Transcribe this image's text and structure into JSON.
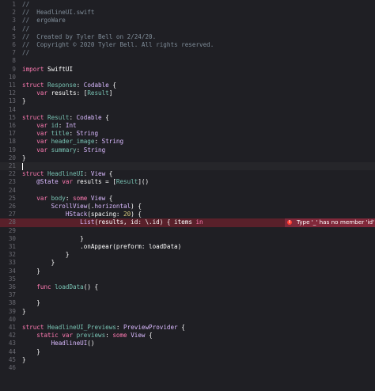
{
  "colors": {
    "background": "#1f1f24",
    "gutter": "#6a6a72",
    "comment": "#7f8c98",
    "keyword": "#ff7ab2",
    "type": "#dabaff",
    "identifier": "#78c2b3",
    "number": "#d9c97c",
    "plain": "#ffffff",
    "error_bg": "#80283a",
    "error_icon": "#ff3b30"
  },
  "error": {
    "line": 28,
    "icon": "error-circle-icon",
    "message": "Type '_' has no member 'id'"
  },
  "caret_line": 21,
  "lines": [
    {
      "n": "1",
      "t": [
        [
          "c",
          "//"
        ]
      ]
    },
    {
      "n": "2",
      "t": [
        [
          "c",
          "//  HeadlineUI.swift"
        ]
      ]
    },
    {
      "n": "3",
      "t": [
        [
          "c",
          "//  ergoWare"
        ]
      ]
    },
    {
      "n": "4",
      "t": [
        [
          "c",
          "//"
        ]
      ]
    },
    {
      "n": "5",
      "t": [
        [
          "c",
          "//  Created by Tyler Bell on 2/24/20."
        ]
      ]
    },
    {
      "n": "6",
      "t": [
        [
          "c",
          "//  Copyright © 2020 Tyler Bell. All rights reserved."
        ]
      ]
    },
    {
      "n": "7",
      "t": [
        [
          "c",
          "//"
        ]
      ]
    },
    {
      "n": "8",
      "t": []
    },
    {
      "n": "9",
      "t": [
        [
          "k",
          "import"
        ],
        [
          "p",
          " SwiftUI"
        ]
      ]
    },
    {
      "n": "10",
      "t": []
    },
    {
      "n": "11",
      "t": [
        [
          "k",
          "struct"
        ],
        [
          "p",
          " "
        ],
        [
          "i",
          "Response"
        ],
        [
          "p",
          ": "
        ],
        [
          "ty",
          "Codable"
        ],
        [
          "p",
          " {"
        ]
      ]
    },
    {
      "n": "12",
      "t": [
        [
          "p",
          "    "
        ],
        [
          "k",
          "var"
        ],
        [
          "p",
          " results: ["
        ],
        [
          "i",
          "Result"
        ],
        [
          "p",
          "]"
        ]
      ]
    },
    {
      "n": "13",
      "t": [
        [
          "p",
          "}"
        ]
      ]
    },
    {
      "n": "14",
      "t": []
    },
    {
      "n": "15",
      "t": [
        [
          "k",
          "struct"
        ],
        [
          "p",
          " "
        ],
        [
          "i",
          "Result"
        ],
        [
          "p",
          ": "
        ],
        [
          "ty",
          "Codable"
        ],
        [
          "p",
          " {"
        ]
      ]
    },
    {
      "n": "16",
      "t": [
        [
          "p",
          "    "
        ],
        [
          "k",
          "var"
        ],
        [
          "p",
          " "
        ],
        [
          "i",
          "id"
        ],
        [
          "p",
          ": "
        ],
        [
          "ty",
          "Int"
        ]
      ]
    },
    {
      "n": "17",
      "t": [
        [
          "p",
          "    "
        ],
        [
          "k",
          "var"
        ],
        [
          "p",
          " "
        ],
        [
          "i",
          "title"
        ],
        [
          "p",
          ": "
        ],
        [
          "ty",
          "String"
        ]
      ]
    },
    {
      "n": "18",
      "t": [
        [
          "p",
          "    "
        ],
        [
          "k",
          "var"
        ],
        [
          "p",
          " "
        ],
        [
          "i",
          "header_image"
        ],
        [
          "p",
          ": "
        ],
        [
          "ty",
          "String"
        ]
      ]
    },
    {
      "n": "19",
      "t": [
        [
          "p",
          "    "
        ],
        [
          "k",
          "var"
        ],
        [
          "p",
          " "
        ],
        [
          "i",
          "summary"
        ],
        [
          "p",
          ": "
        ],
        [
          "ty",
          "String"
        ]
      ]
    },
    {
      "n": "20",
      "t": [
        [
          "p",
          "}"
        ]
      ]
    },
    {
      "n": "21",
      "t": []
    },
    {
      "n": "22",
      "t": [
        [
          "k",
          "struct"
        ],
        [
          "p",
          " "
        ],
        [
          "i",
          "HeadlineUI"
        ],
        [
          "p",
          ": "
        ],
        [
          "ty",
          "View"
        ],
        [
          "p",
          " {"
        ]
      ]
    },
    {
      "n": "23",
      "t": [
        [
          "p",
          "    "
        ],
        [
          "ty",
          "@State"
        ],
        [
          "p",
          " "
        ],
        [
          "k",
          "var"
        ],
        [
          "p",
          " results = ["
        ],
        [
          "i",
          "Result"
        ],
        [
          "p",
          "]()"
        ]
      ]
    },
    {
      "n": "24",
      "t": []
    },
    {
      "n": "25",
      "t": [
        [
          "p",
          "    "
        ],
        [
          "k",
          "var"
        ],
        [
          "p",
          " "
        ],
        [
          "i",
          "body"
        ],
        [
          "p",
          ": "
        ],
        [
          "k",
          "some"
        ],
        [
          "p",
          " "
        ],
        [
          "ty",
          "View"
        ],
        [
          "p",
          " {"
        ]
      ]
    },
    {
      "n": "26",
      "t": [
        [
          "p",
          "        "
        ],
        [
          "ty",
          "ScrollView"
        ],
        [
          "p",
          "(."
        ],
        [
          "ty",
          "horizontal"
        ],
        [
          "p",
          ") {"
        ]
      ]
    },
    {
      "n": "27",
      "t": [
        [
          "p",
          "            "
        ],
        [
          "ty",
          "HStack"
        ],
        [
          "p",
          "(spacing: "
        ],
        [
          "num",
          "20"
        ],
        [
          "p",
          ") {"
        ]
      ]
    },
    {
      "n": "28",
      "t": [
        [
          "p",
          "                "
        ],
        [
          "ty",
          "List"
        ],
        [
          "p",
          "(results, id: \\.id) { items "
        ],
        [
          "k",
          "in"
        ]
      ]
    },
    {
      "n": "29",
      "t": []
    },
    {
      "n": "30",
      "t": [
        [
          "p",
          "                }"
        ]
      ]
    },
    {
      "n": "31",
      "t": [
        [
          "p",
          "                .onAppear(preform: loadData)"
        ]
      ]
    },
    {
      "n": "32",
      "t": [
        [
          "p",
          "            }"
        ]
      ]
    },
    {
      "n": "33",
      "t": [
        [
          "p",
          "        }"
        ]
      ]
    },
    {
      "n": "34",
      "t": [
        [
          "p",
          "    }"
        ]
      ]
    },
    {
      "n": "35",
      "t": []
    },
    {
      "n": "36",
      "t": [
        [
          "p",
          "    "
        ],
        [
          "k",
          "func"
        ],
        [
          "p",
          " "
        ],
        [
          "i",
          "loadData"
        ],
        [
          "p",
          "() {"
        ]
      ]
    },
    {
      "n": "37",
      "t": []
    },
    {
      "n": "38",
      "t": [
        [
          "p",
          "    }"
        ]
      ]
    },
    {
      "n": "39",
      "t": [
        [
          "p",
          "}"
        ]
      ]
    },
    {
      "n": "40",
      "t": []
    },
    {
      "n": "41",
      "t": [
        [
          "k",
          "struct"
        ],
        [
          "p",
          " "
        ],
        [
          "i",
          "HeadlineUI_Previews"
        ],
        [
          "p",
          ": "
        ],
        [
          "ty",
          "PreviewProvider"
        ],
        [
          "p",
          " {"
        ]
      ]
    },
    {
      "n": "42",
      "t": [
        [
          "p",
          "    "
        ],
        [
          "k",
          "static"
        ],
        [
          "p",
          " "
        ],
        [
          "k",
          "var"
        ],
        [
          "p",
          " "
        ],
        [
          "i",
          "previews"
        ],
        [
          "p",
          ": "
        ],
        [
          "k",
          "some"
        ],
        [
          "p",
          " "
        ],
        [
          "ty",
          "View"
        ],
        [
          "p",
          " {"
        ]
      ]
    },
    {
      "n": "43",
      "t": [
        [
          "p",
          "        "
        ],
        [
          "ty",
          "HeadlineUI"
        ],
        [
          "p",
          "()"
        ]
      ]
    },
    {
      "n": "44",
      "t": [
        [
          "p",
          "    }"
        ]
      ]
    },
    {
      "n": "45",
      "t": [
        [
          "p",
          "}"
        ]
      ]
    },
    {
      "n": "46",
      "t": []
    }
  ]
}
